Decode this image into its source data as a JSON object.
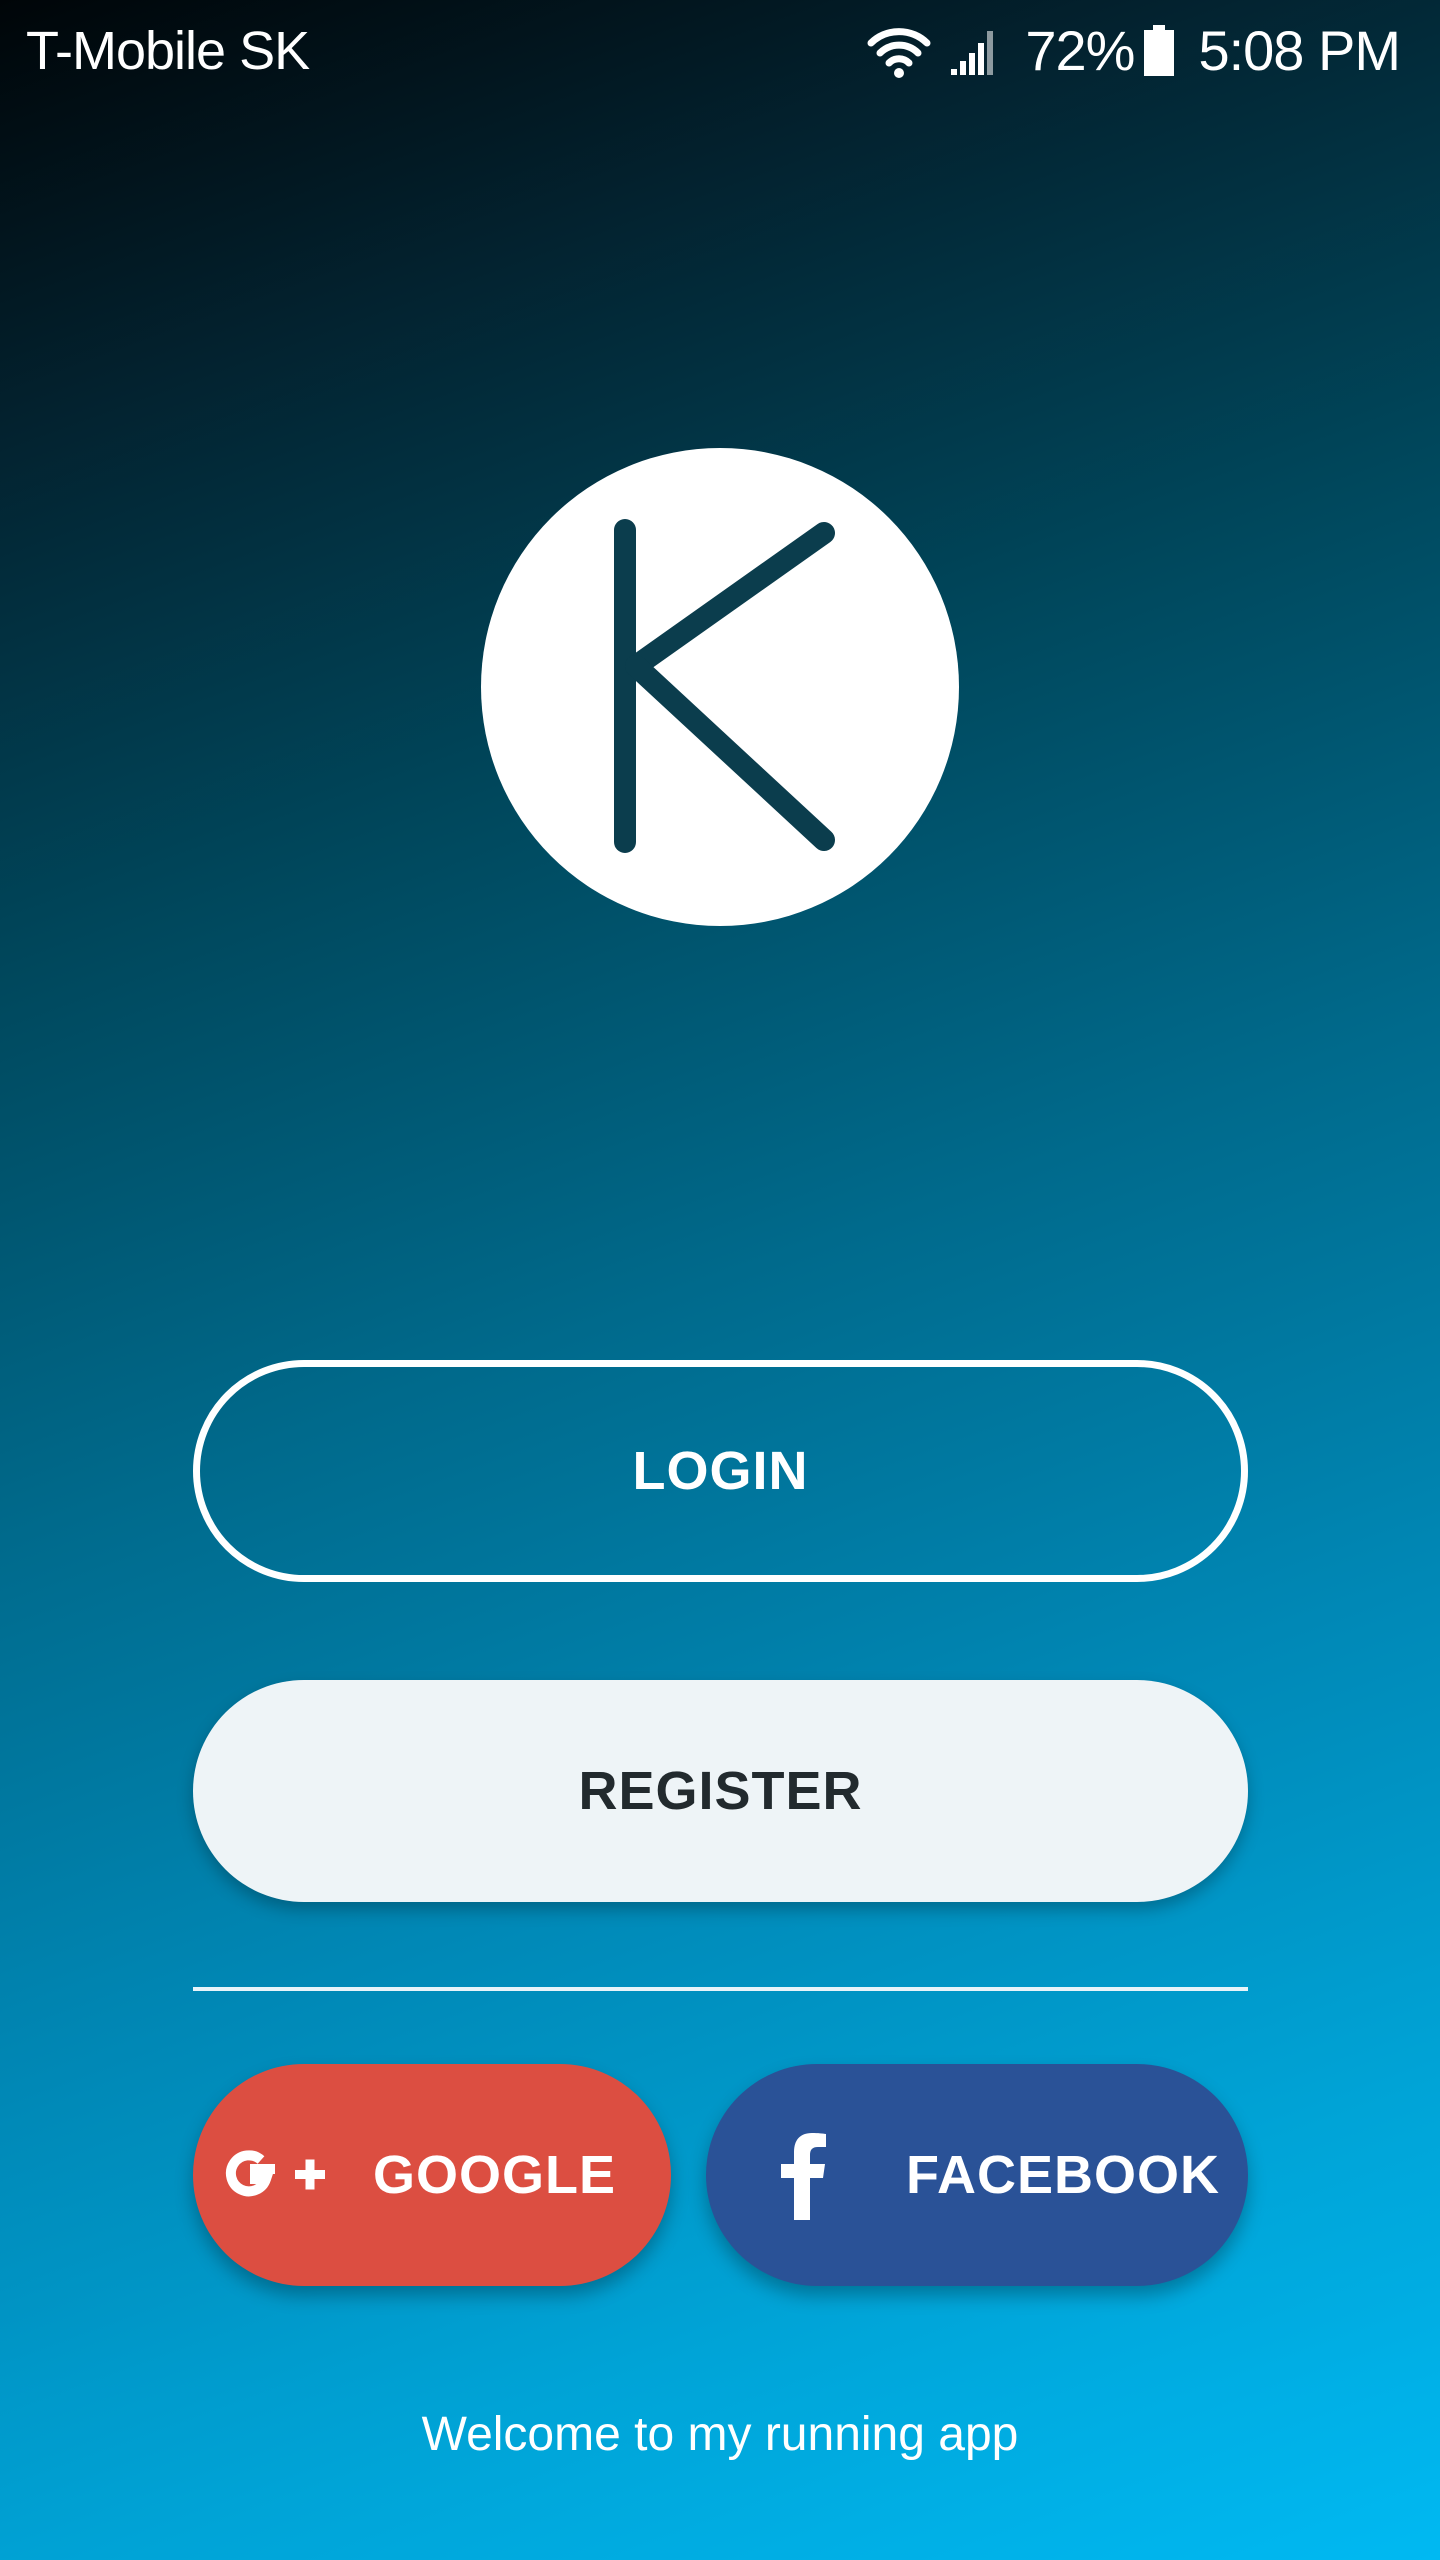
{
  "status_bar": {
    "carrier": "T-Mobile SK",
    "battery": "72%",
    "time": "5:08 PM",
    "icons": [
      "wifi-icon",
      "signal-icon",
      "battery-icon"
    ]
  },
  "logo": {
    "letter": "K",
    "icon": "app-logo"
  },
  "buttons": {
    "login": "LOGIN",
    "register": "REGISTER",
    "google": "GOOGLE",
    "facebook": "FACEBOOK"
  },
  "footer": {
    "welcome": "Welcome to my running app"
  },
  "colors": {
    "gradient_top": "#000508",
    "gradient_bottom": "#00b9f2",
    "register_bg": "#eef4f7",
    "google_red": "#dc4e41",
    "facebook_blue": "#2a5297",
    "logo_letter": "#0b3d4d"
  }
}
